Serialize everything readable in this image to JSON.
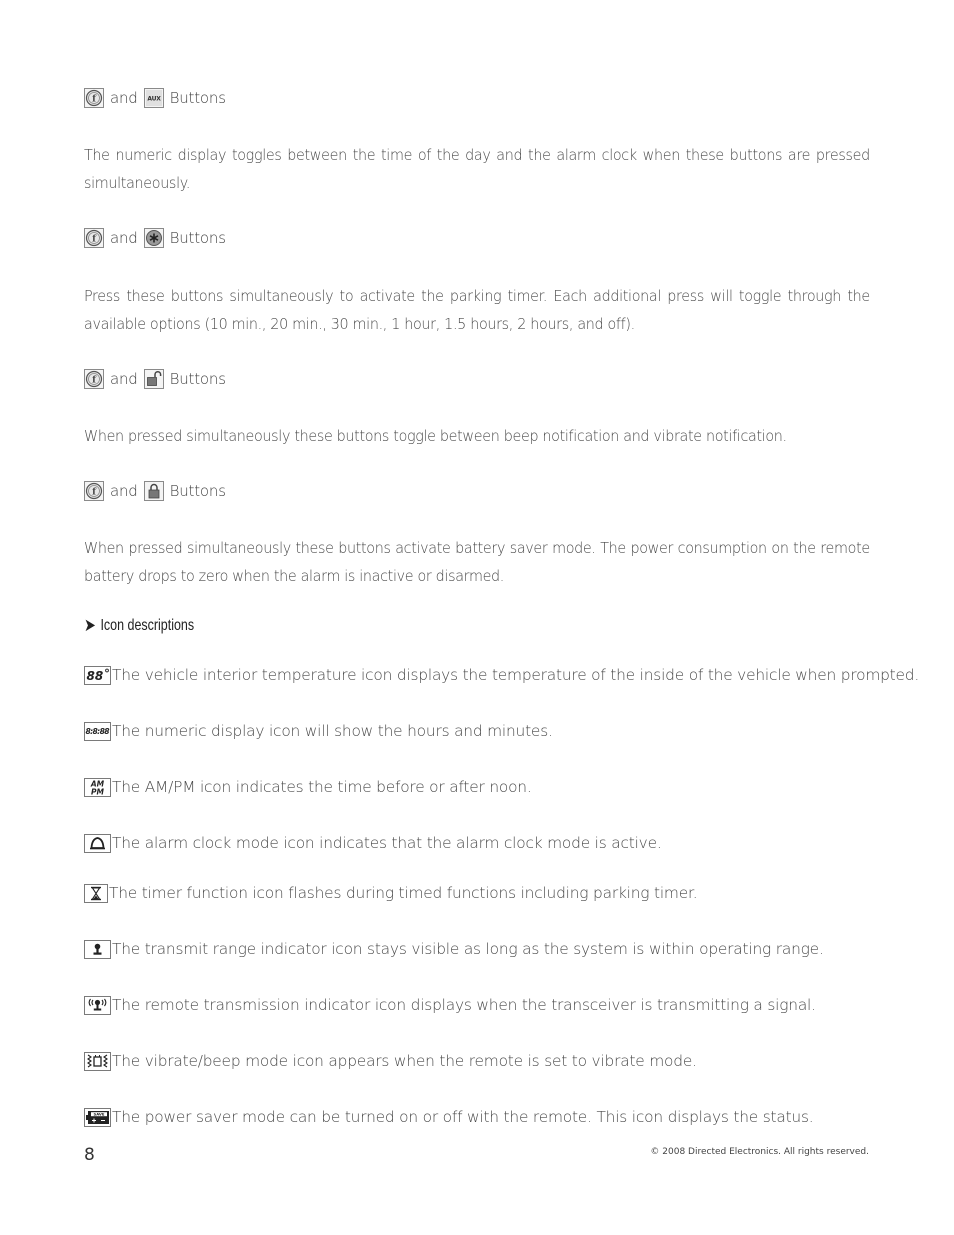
{
  "button_pairs": [
    {
      "first_icon": "f-function-button-icon",
      "second_icon": "aux-button-icon",
      "second_icon_label": "AUX",
      "connector": "and",
      "suffix": "Buttons",
      "description": "The numeric display toggles between the time of the day and the alarm clock when these buttons are pressed simultaneously."
    },
    {
      "first_icon": "f-function-button-icon",
      "second_icon": "asterisk-button-icon",
      "connector": "and",
      "suffix": "Buttons",
      "description": "Press these buttons simultaneously to activate the parking timer. Each additional press will toggle through the available options (10 min., 20 min., 30 min., 1 hour, 1.5 hours, 2 hours, and off)."
    },
    {
      "first_icon": "f-function-button-icon",
      "second_icon": "unlock-button-icon",
      "connector": "and",
      "suffix": "Buttons",
      "description": "When pressed simultaneously these buttons toggle between beep notification and vibrate notification."
    },
    {
      "first_icon": "f-function-button-icon",
      "second_icon": "lock-button-icon",
      "connector": "and",
      "suffix": "Buttons",
      "description": "When pressed simultaneously these buttons activate battery saver mode. The power consumption on the remote battery drops to zero when the alarm is inactive or disarmed."
    }
  ],
  "section": {
    "arrow": "➤",
    "title": "Icon descriptions"
  },
  "icon_descriptions": [
    {
      "icon": "temperature-icon",
      "icon_text": "88°",
      "text": "The vehicle interior temperature icon displays the temperature of the inside of the vehicle when prompted."
    },
    {
      "icon": "numeric-display-icon",
      "icon_text": "8:8:88",
      "text": "The numeric display icon will show the hours and minutes."
    },
    {
      "icon": "am-pm-icon",
      "icon_text_top": "AM",
      "icon_text_bottom": "PM",
      "text": "The AM/PM icon indicates the time before or after noon."
    },
    {
      "icon": "alarm-bell-icon",
      "text": "The alarm clock mode icon indicates that the alarm clock mode is active."
    },
    {
      "icon": "hourglass-icon",
      "text": "The timer function icon flashes during timed functions including parking timer."
    },
    {
      "icon": "transmit-range-icon",
      "text": "The transmit range indicator icon stays visible as long as the system is within operating range."
    },
    {
      "icon": "remote-transmission-icon",
      "text": "The remote transmission indicator icon displays when the transceiver is transmitting a signal."
    },
    {
      "icon": "vibrate-beep-icon",
      "text": "The vibrate/beep mode icon appears when the remote is set to vibrate mode."
    },
    {
      "icon": "power-saver-icon",
      "icon_text": "SAVE",
      "text": "The power saver mode can be turned on or off with the remote. This icon displays the status."
    }
  ],
  "footer": {
    "page_number": "8",
    "copyright": "© 2008 Directed Electronics. All rights reserved."
  }
}
